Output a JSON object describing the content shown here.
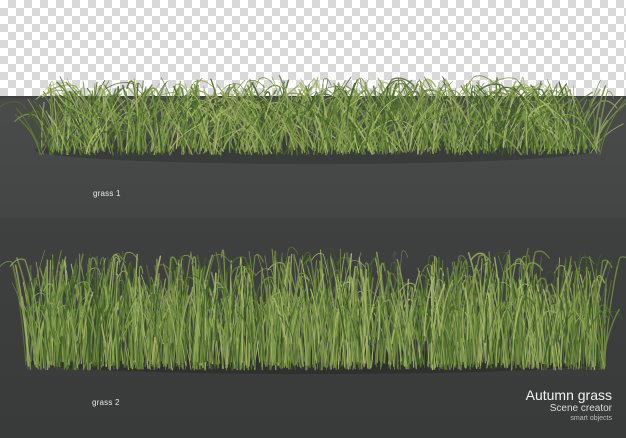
{
  "labels": {
    "grass1": "grass 1",
    "grass2": "grass 2"
  },
  "brand": {
    "title": "Autumn grass",
    "subtitle": "Scene creator",
    "tagline": "smart objects"
  },
  "colors": {
    "checker_light": "#ffffff",
    "checker_dark": "#d9d9d9",
    "panel_top": "#4a4b4b",
    "panel_bottom": "#3a3b3b",
    "grass_dark": "#3f5a26",
    "grass_mid": "#6f8a3e",
    "grass_light": "#a9b86a"
  }
}
